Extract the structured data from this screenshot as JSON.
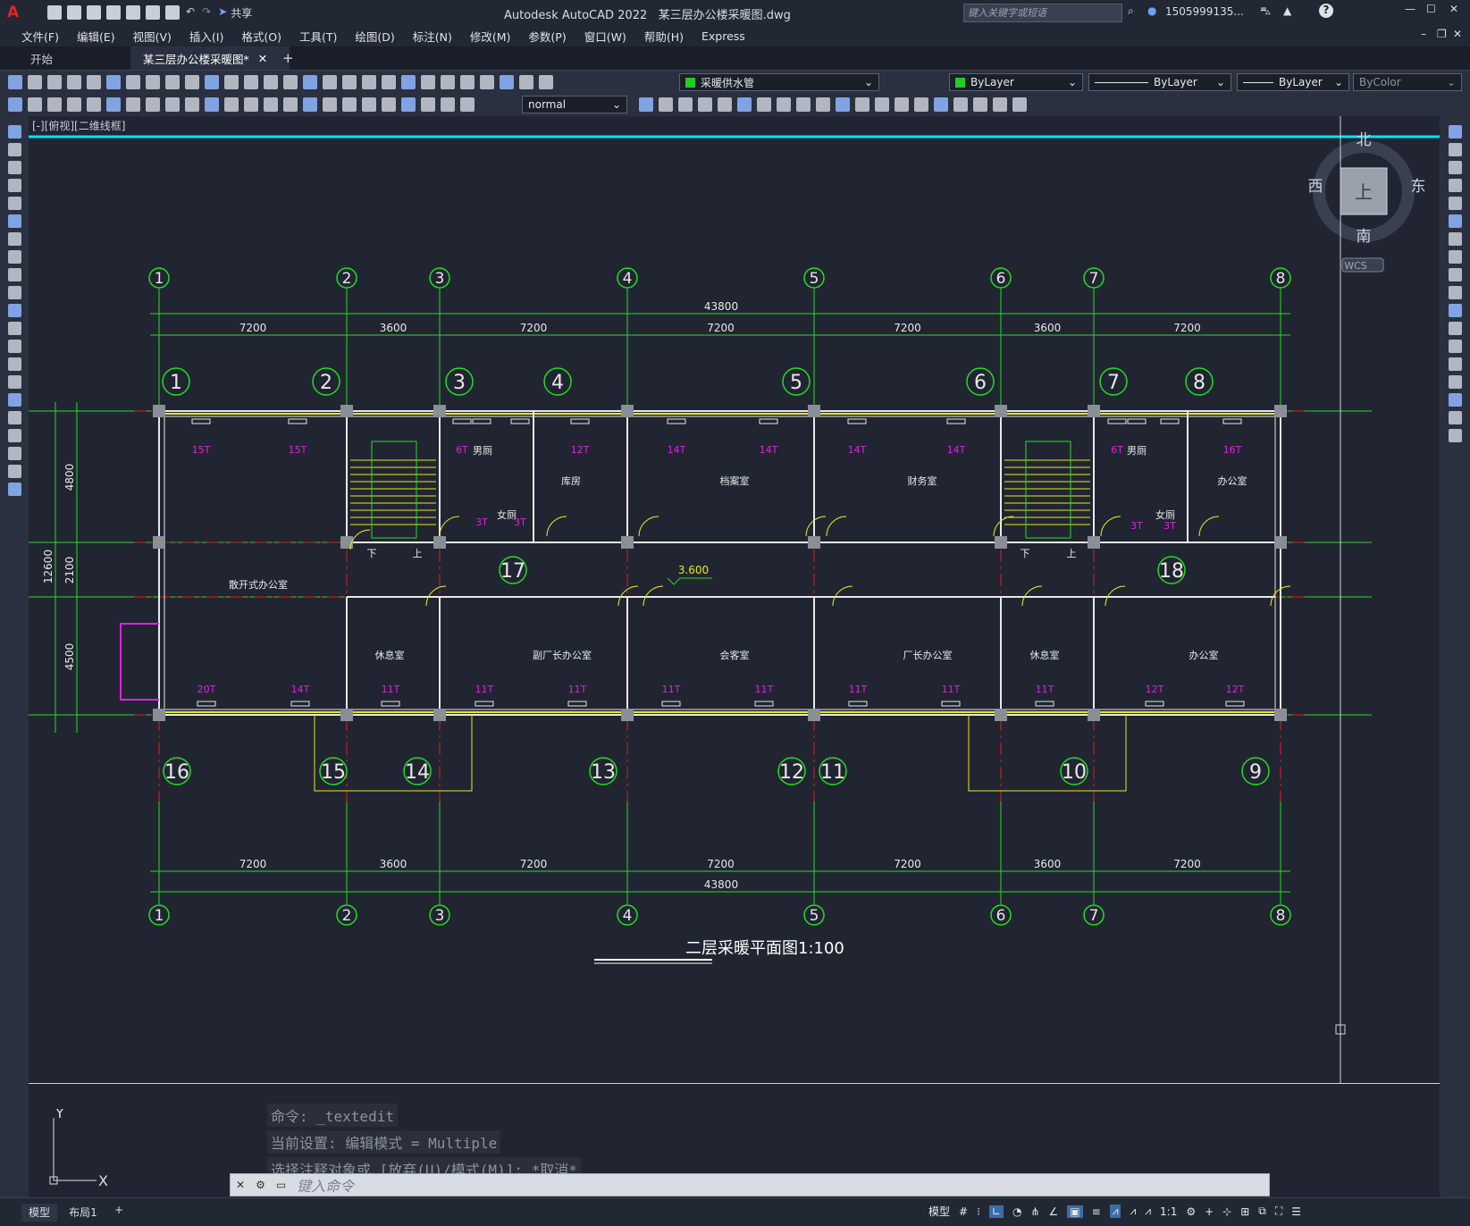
{
  "app": {
    "logo": "A",
    "title": "Autodesk AutoCAD 2022",
    "filename": "某三层办公楼采暖图.dwg",
    "share_label": "共享",
    "search_placeholder": "键入关键字或短语",
    "user": "1505999135...",
    "help": "?"
  },
  "menu": [
    "文件(F)",
    "编辑(E)",
    "视图(V)",
    "插入(I)",
    "格式(O)",
    "工具(T)",
    "绘图(D)",
    "标注(N)",
    "修改(M)",
    "参数(P)",
    "窗口(W)",
    "帮助(H)",
    "Express"
  ],
  "tabs": [
    {
      "label": "开始",
      "active": false
    },
    {
      "label": "某三层办公楼采暖图*",
      "active": true
    }
  ],
  "toolbar": {
    "layer": "采暖供水管",
    "layer_color": "#22cc22",
    "color": "ByLayer",
    "linetype": "ByLayer",
    "lineweight": "ByLayer",
    "plotstyle": "ByColor",
    "textstyle": "normal"
  },
  "viewport_label": "[-][俯视][二维线框]",
  "viewcube": {
    "north": "北",
    "south": "南",
    "east": "东",
    "west": "西",
    "top": "上",
    "wcs": "WCS"
  },
  "plan": {
    "title": "二层采暖平面图1:100",
    "overall_dim": "43800",
    "bay_dims": [
      "7200",
      "3600",
      "7200",
      "7200",
      "7200",
      "3600",
      "7200"
    ],
    "axis_labels": [
      "1",
      "2",
      "3",
      "4",
      "5",
      "6",
      "7",
      "8"
    ],
    "side_dims": [
      "4800",
      "2100",
      "4500"
    ],
    "side_overall": "12600",
    "elevation": "3.600",
    "rooms": [
      "散开式办公室",
      "库房",
      "档案室",
      "财务室",
      "办公室",
      "休息室",
      "副厂长办公室",
      "会客室",
      "厂长办公室",
      "休息室",
      "办公室",
      "男厕",
      "女厕",
      "男厕",
      "女厕"
    ],
    "radiators": [
      "15T",
      "15T",
      "6T",
      "12T",
      "14T",
      "14T",
      "14T",
      "14T",
      "6T",
      "16T",
      "20T",
      "14T",
      "11T",
      "11T",
      "11T",
      "11T",
      "11T",
      "11T",
      "11T",
      "11T",
      "12T",
      "12T",
      "3T",
      "3T",
      "3T",
      "3T"
    ],
    "riser_labels": [
      "1",
      "2",
      "3",
      "4",
      "5",
      "6",
      "7",
      "8",
      "9",
      "10",
      "11",
      "12",
      "13",
      "14",
      "15",
      "16",
      "17",
      "18"
    ],
    "stair_labels": [
      "下",
      "上",
      "下",
      "上"
    ]
  },
  "command": {
    "history": [
      "命令: _textedit",
      "当前设置: 编辑模式 = Multiple",
      "选择注释对象或 [放弃(U)/模式(M)]: *取消*"
    ],
    "placeholder": "键入命令"
  },
  "ucs": {
    "x": "X",
    "y": "Y"
  },
  "layout_tabs": [
    "模型",
    "布局1"
  ],
  "status": {
    "model": "模型",
    "scale": "1:1"
  }
}
